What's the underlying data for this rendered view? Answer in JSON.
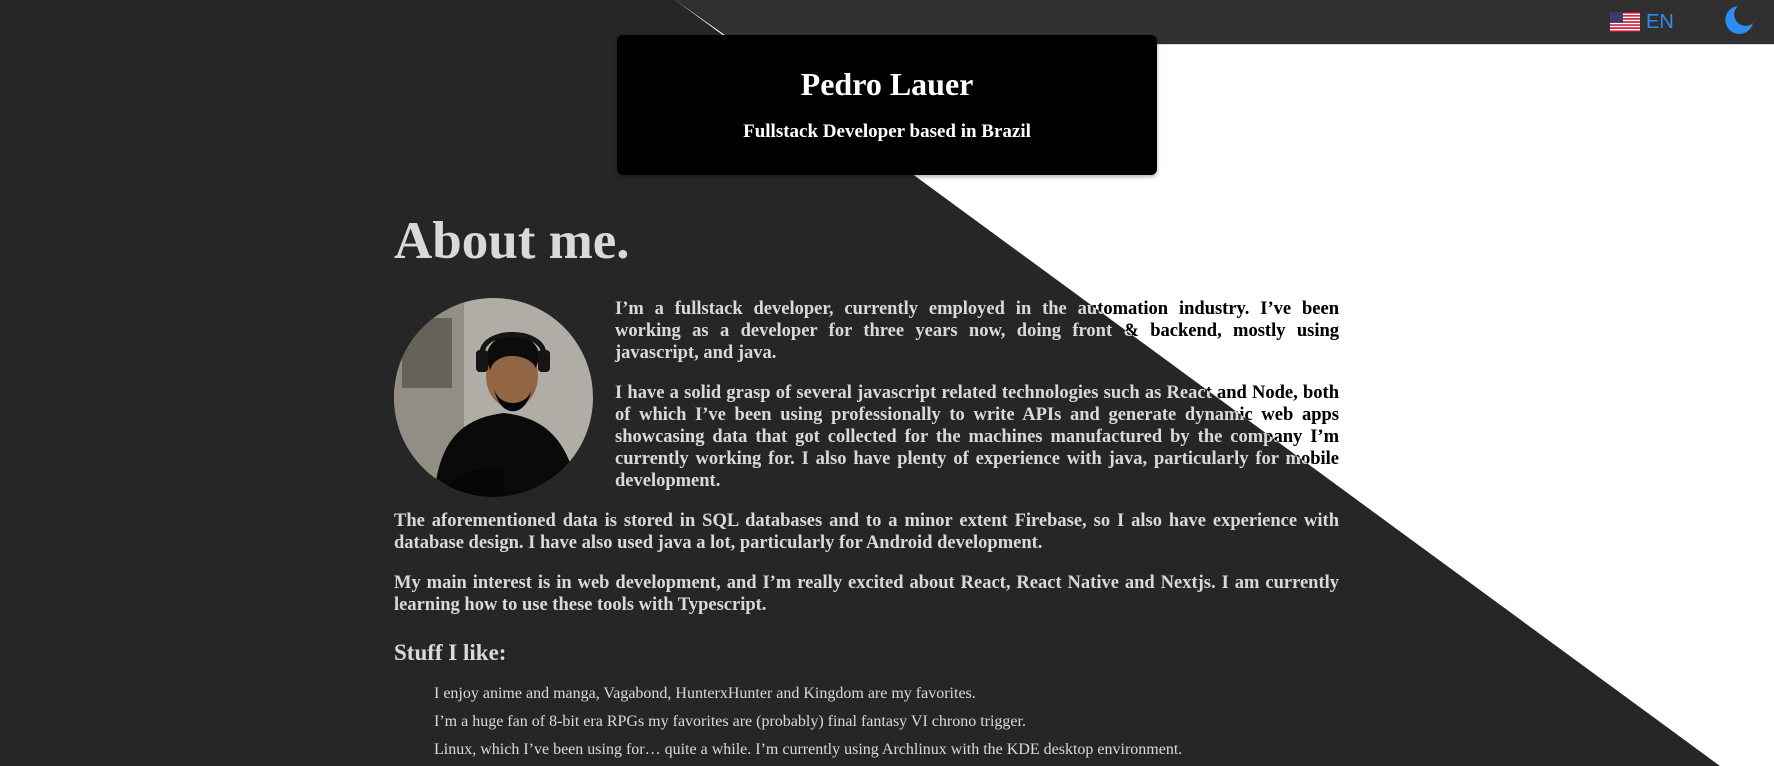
{
  "topbar": {
    "language_label": "EN",
    "flag_icon": "us-flag-icon",
    "theme_icon": "moon-icon",
    "accent": "#2f8cf0"
  },
  "header": {
    "name": "Pedro Lauer",
    "subtitle": "Fullstack Developer based in Brazil"
  },
  "about": {
    "heading": "About me.",
    "avatar_alt": "Photo of Pedro Lauer",
    "paragraphs": [
      "I’m a fullstack developer, currently employed in the automation industry. I’ve been working as a developer for three years now, doing front & backend, mostly using javascript, and java.",
      "I have a solid grasp of several javascript related technologies such as React and Node, both of which I’ve been using professionally to write APIs and generate dynamic web apps showcasing data that got collected for the machines manufactured by the company I’m currently working for. I also have plenty of experience with java, particularly for mobile development.",
      "The aforementioned data is stored in SQL databases and to a minor extent Firebase, so I also have experience with database design. I have also used java a lot, particularly for Android development.",
      "My main interest is in web development, and I’m really excited about React, React Native and Nextjs. I am currently learning how to use these tools with Typescript."
    ]
  },
  "stuff": {
    "heading": "Stuff I like:",
    "items": [
      "I enjoy anime and manga, Vagabond, HunterxHunter and Kingdom are my favorites.",
      "I’m a huge fan of 8-bit era RPGs my favorites are (probably) final fantasy VI chrono trigger.",
      "Linux, which I’ve been using for… quite a while. I’m currently using Archlinux with the KDE desktop environment."
    ]
  },
  "colors": {
    "dark_bg": "#262626",
    "light_bg": "#ffffff",
    "card_bg": "#000000"
  }
}
